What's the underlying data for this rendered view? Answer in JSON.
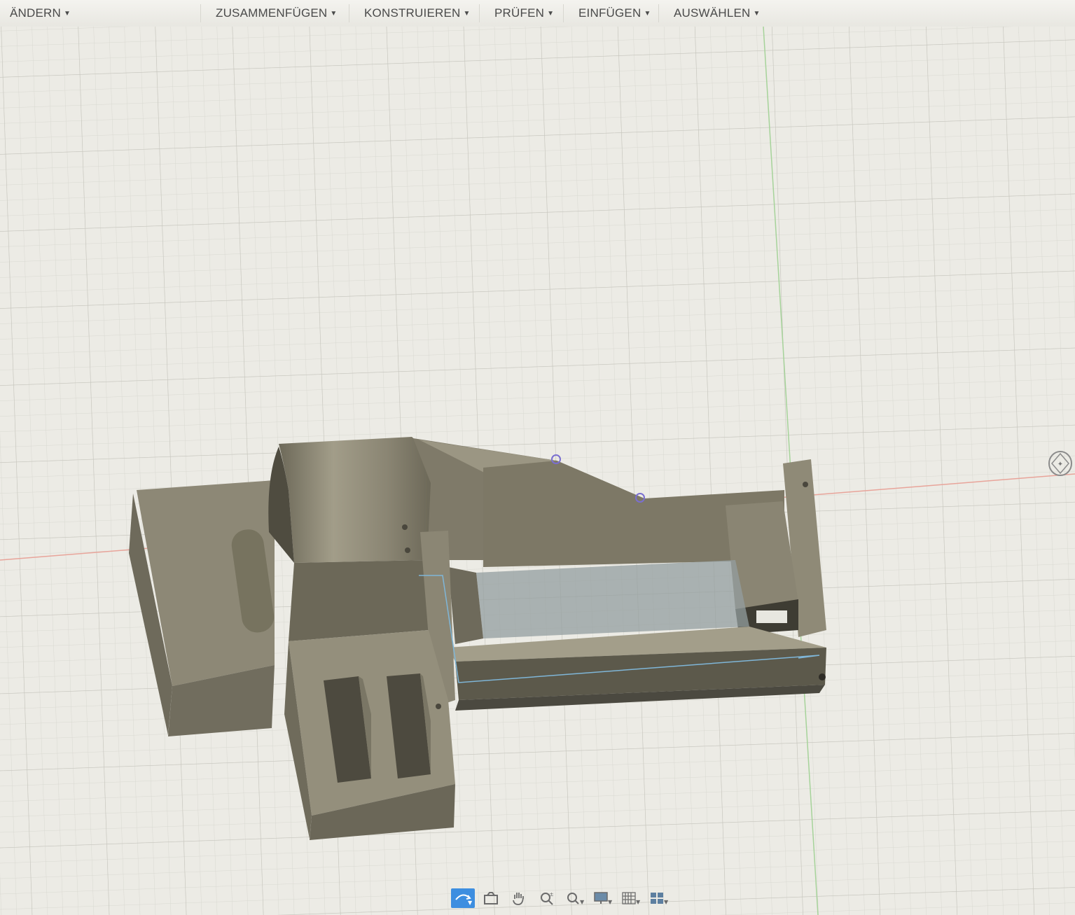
{
  "toolbar": {
    "menus": [
      {
        "label": "ÄNDERN"
      },
      {
        "label": "ZUSAMMENFÜGEN"
      },
      {
        "label": "KONSTRUIEREN"
      },
      {
        "label": "PRÜFEN"
      },
      {
        "label": "EINFÜGEN"
      },
      {
        "label": "AUSWÄHLEN"
      }
    ]
  },
  "navbar": {
    "tools": [
      {
        "icon": "orbit-icon",
        "active": true
      },
      {
        "icon": "look-at-icon"
      },
      {
        "icon": "pan-hand-icon"
      },
      {
        "icon": "zoom-icon"
      },
      {
        "icon": "zoom-window-icon"
      },
      {
        "icon": "display-settings-icon"
      },
      {
        "icon": "grid-settings-icon"
      },
      {
        "icon": "viewports-icon"
      }
    ]
  },
  "colors": {
    "grid_bg": "#ecebe5",
    "grid_line": "#d6d5ce",
    "grid_major": "#c9c8c0",
    "axis_red": "#e8a49a",
    "axis_green": "#a6d39a",
    "model_face": "#8c8776",
    "model_dark": "#6a6657",
    "model_light": "#a9a491",
    "accent": "#3d8ee0"
  }
}
